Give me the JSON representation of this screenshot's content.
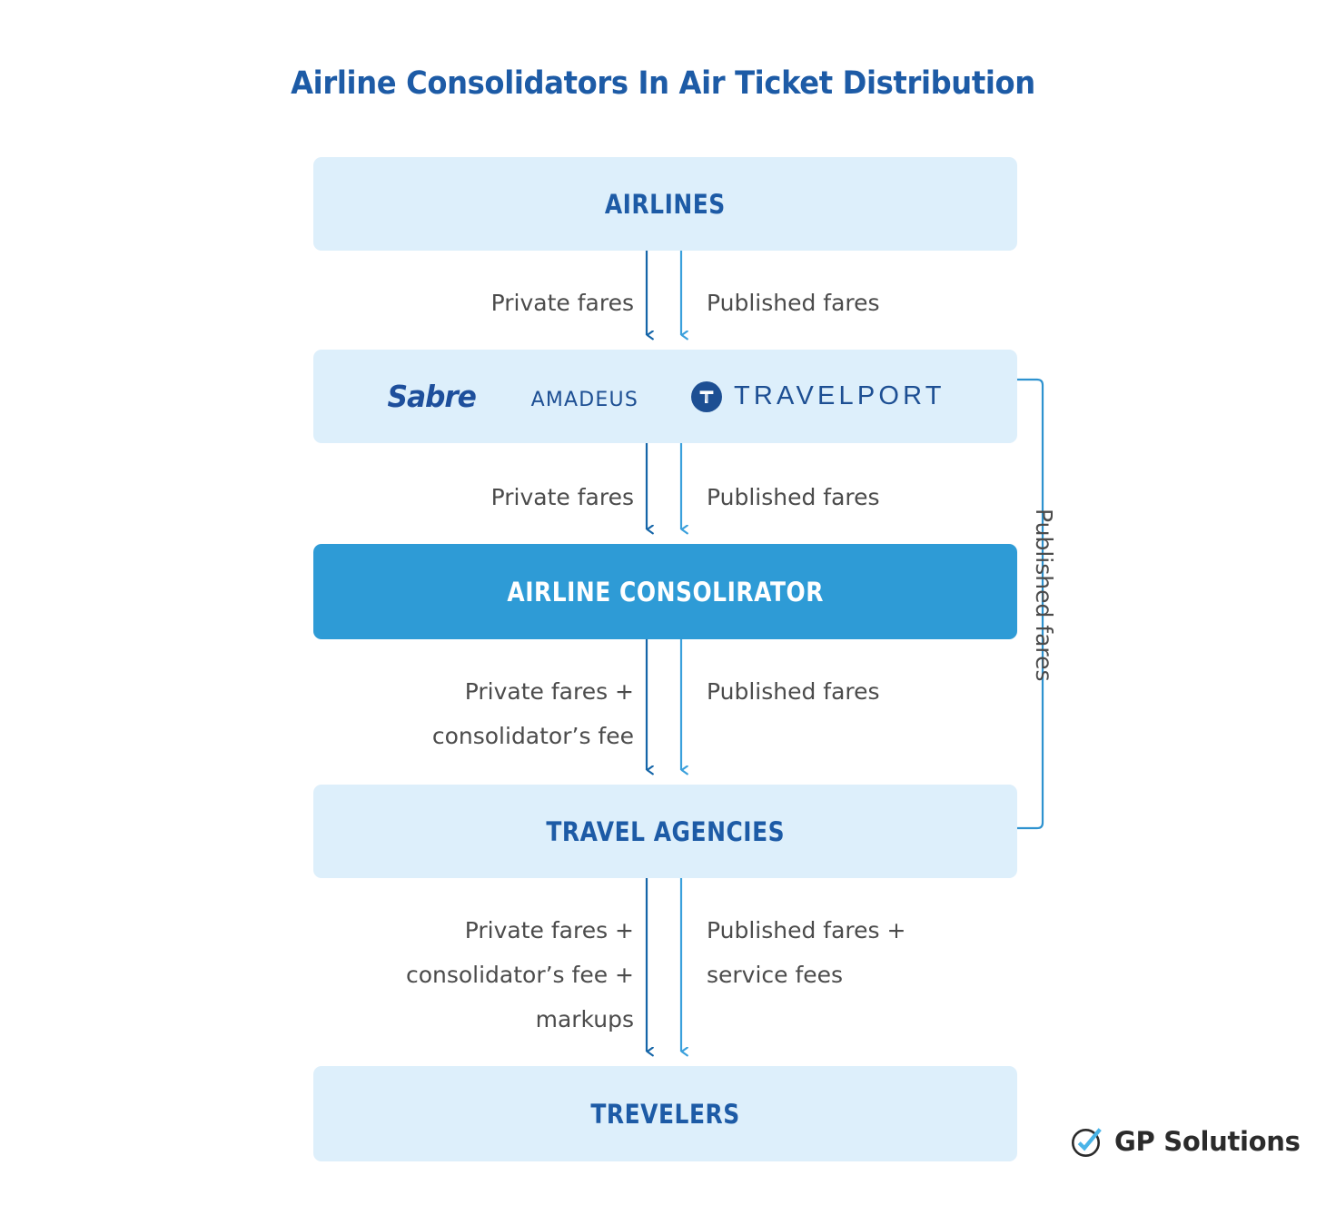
{
  "title": "Airline Consolidators In Air Ticket Distribution",
  "colors": {
    "title_blue": "#1d5ba6",
    "node_light_bg": "#ddeffb",
    "node_accent_bg": "#2e9bd6",
    "node_label_blue": "#1d5ba6",
    "arrow_private": "#1565a8",
    "arrow_published": "#3aa0dc",
    "edge_label_gray": "#4b4b4b",
    "logo_blue": "#1d4f93",
    "gp_check_blue": "#49b4e8",
    "gp_text_dark": "#2b2b2b"
  },
  "nodes": {
    "airlines": {
      "label": "AIRLINES"
    },
    "gds": {
      "logos": [
        {
          "name": "sabre-logo",
          "text": "Sabre"
        },
        {
          "name": "amadeus-logo",
          "text": "amadeus"
        },
        {
          "name": "travelport-logo",
          "text": "TRAVELPORT"
        }
      ]
    },
    "consolidator": {
      "label": "AIRLINE CONSOLIRATOR"
    },
    "agencies": {
      "label": "TRAVEL AGENCIES"
    },
    "travelers": {
      "label": "TREVELERS"
    }
  },
  "edges": {
    "airlines_to_gds": {
      "left": "Private fares",
      "right": "Published fares"
    },
    "gds_to_consolidator": {
      "left": "Private fares",
      "right": "Published fares"
    },
    "consolidator_to_agencies": {
      "left": "Private fares +\nconsolidator’s fee",
      "right": "Published fares"
    },
    "agencies_to_travelers": {
      "left": "Private fares +\nconsolidator’s fee +\nmarkups",
      "right": "Published fares +\nservice fees"
    },
    "gds_bypass_to_agencies": {
      "label": "Published fares"
    }
  },
  "brand": {
    "name": "GP Solutions"
  }
}
